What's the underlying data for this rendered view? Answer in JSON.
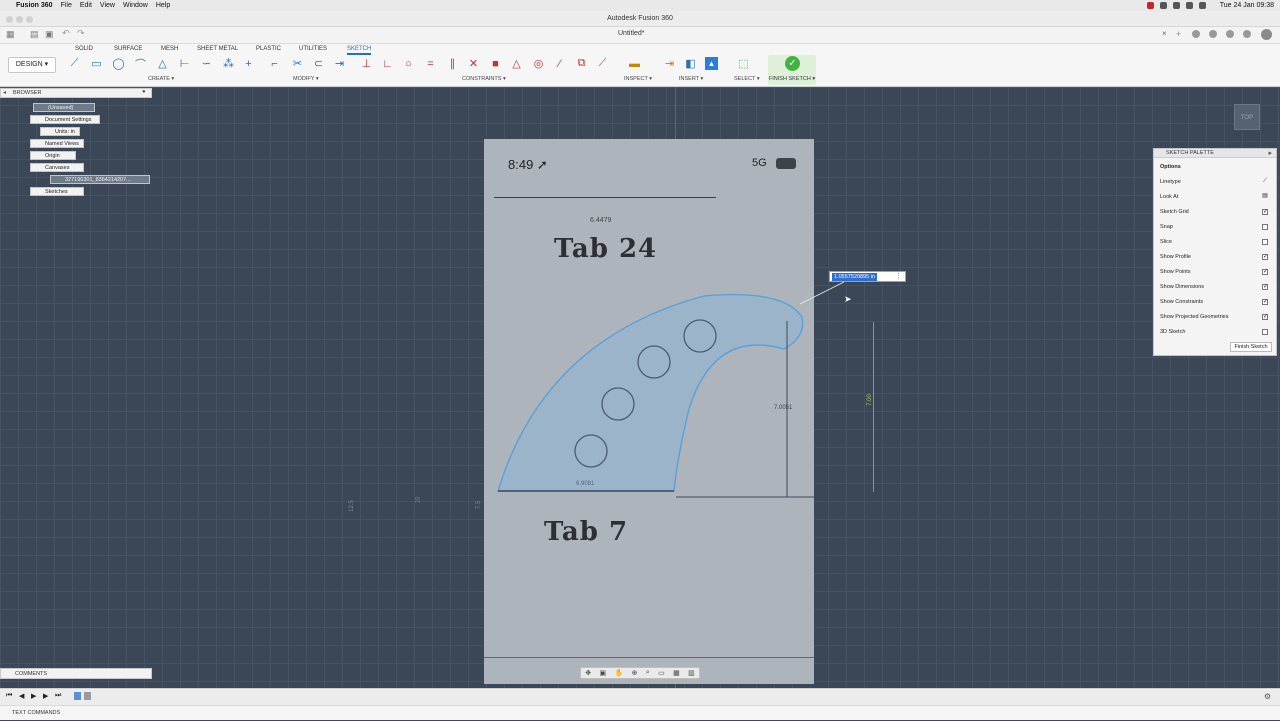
{
  "macbar": {
    "app": "Fusion 360",
    "menus": [
      "File",
      "Edit",
      "View",
      "Window",
      "Help"
    ],
    "clock": "Tue 24 Jan  09:38"
  },
  "window": {
    "title": "Autodesk Fusion 360",
    "doc_tab": "Untitled*"
  },
  "toolbar": {
    "design": "DESIGN ▾",
    "tabs": [
      "SOLID",
      "SURFACE",
      "MESH",
      "SHEET METAL",
      "PLASTIC",
      "UTILITIES",
      "SKETCH"
    ],
    "groups": {
      "create": "CREATE ▾",
      "modify": "MODIFY ▾",
      "constraints": "CONSTRAINTS ▾",
      "inspect": "INSPECT ▾",
      "insert": "INSERT ▾",
      "select": "SELECT ▾"
    },
    "finish": "FINISH SKETCH ▾"
  },
  "browser": {
    "title": "BROWSER",
    "nodes": [
      "(Unsaved)",
      "Document Settings",
      "Units: in",
      "Named Views",
      "Origin",
      "Canvases",
      "327196301_8364214207...",
      "Sketches"
    ]
  },
  "canvas_image": {
    "time": "8:49 ➚",
    "signal": "5G",
    "dim_top": "6.4479",
    "title_top": "Tab 24",
    "title_bottom": "Tab 7",
    "dim_bottom": "6.9081",
    "dim_right": "7.0051",
    "dim_vertical": "7.00"
  },
  "dimension_input": {
    "value": "1.0557520895 in"
  },
  "palette": {
    "title": "SKETCH PALETTE",
    "section": "Options",
    "rows": [
      {
        "label": "Linetype",
        "checked": ""
      },
      {
        "label": "Look At",
        "checked": ""
      },
      {
        "label": "Sketch Grid",
        "checked": "✓"
      },
      {
        "label": "Snap",
        "checked": ""
      },
      {
        "label": "Slice",
        "checked": ""
      },
      {
        "label": "Show Profile",
        "checked": "✓"
      },
      {
        "label": "Show Points",
        "checked": "✓"
      },
      {
        "label": "Show Dimensions",
        "checked": "✓"
      },
      {
        "label": "Show Constraints",
        "checked": "✓"
      },
      {
        "label": "Show Projected Geometries",
        "checked": "✓"
      },
      {
        "label": "3D Sketch",
        "checked": ""
      }
    ],
    "finish": "Finish Sketch"
  },
  "comments": "COMMENTS",
  "text_commands": "TEXT COMMANDS",
  "viewcube": "TOP",
  "axis_labels": {
    "a": "12.5",
    "b": "10",
    "c": "7.5"
  }
}
